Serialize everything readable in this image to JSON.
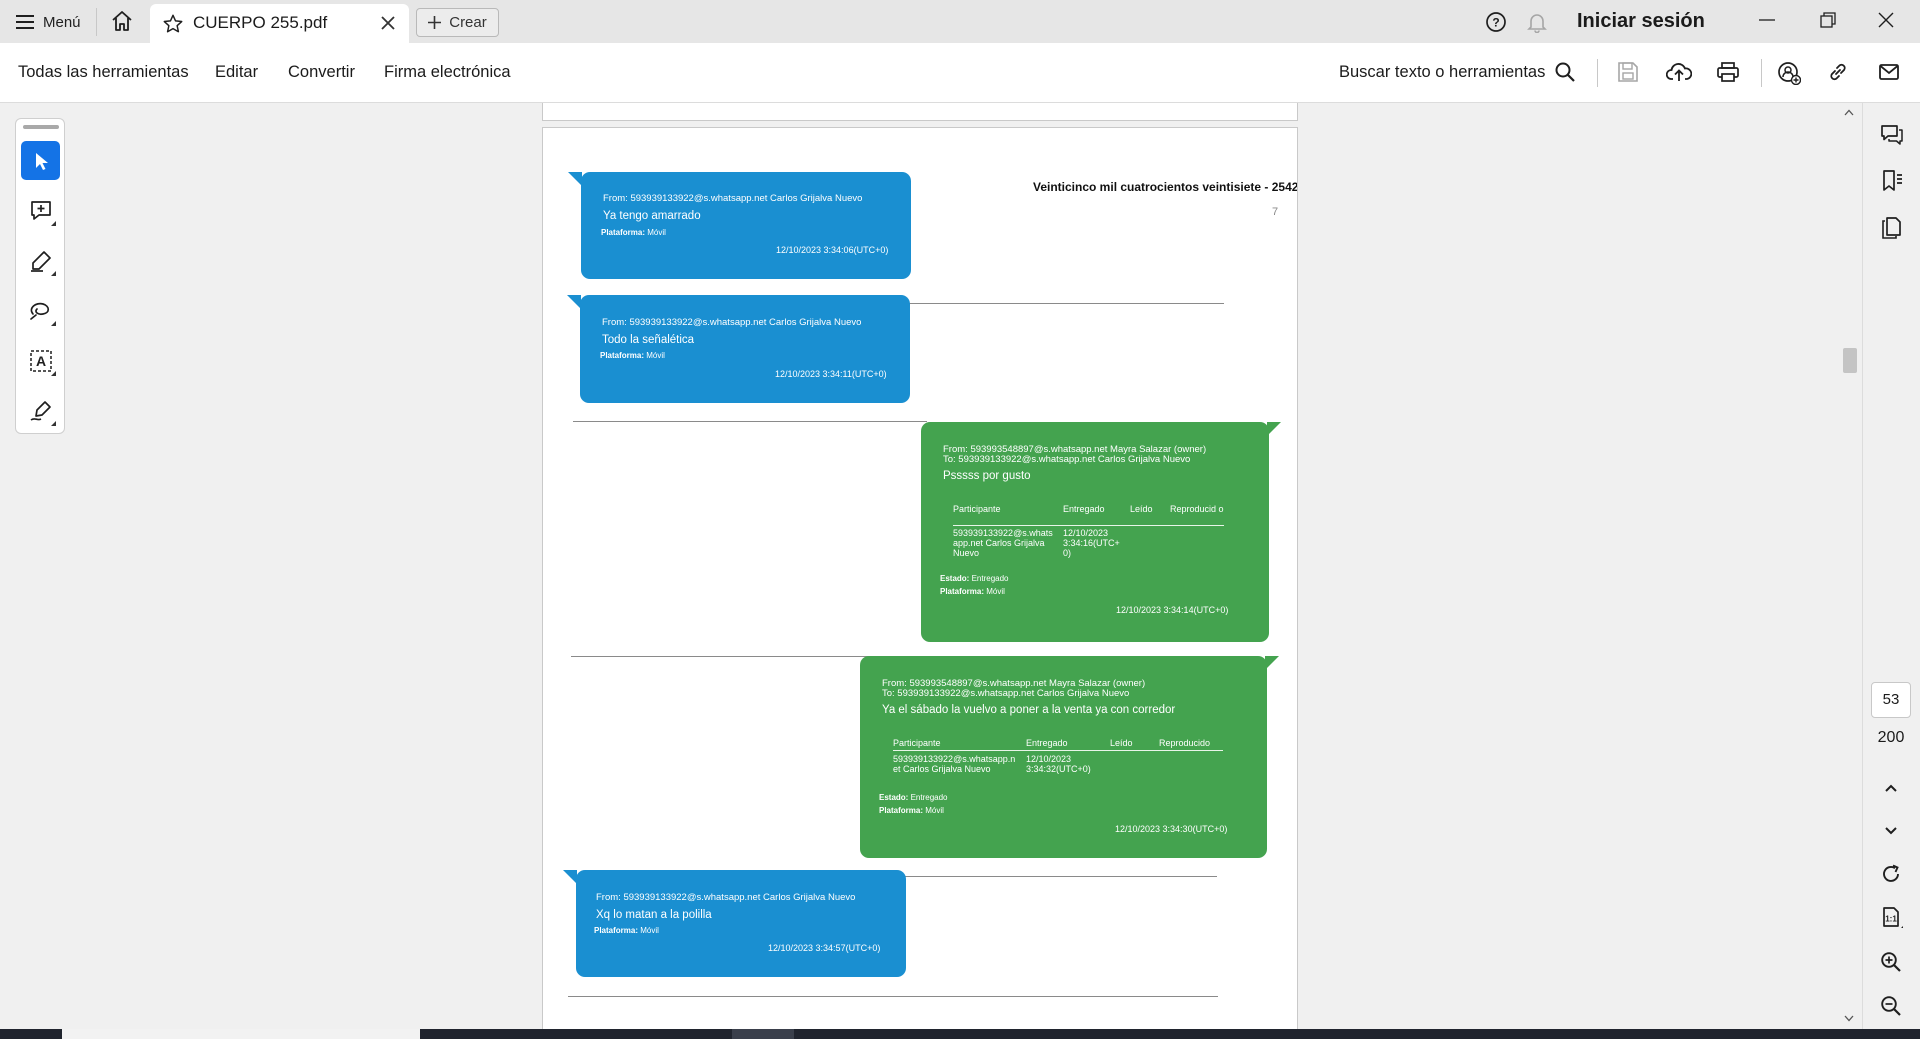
{
  "titlebar": {
    "menu_label": "Menú",
    "tab_title": "CUERPO 255.pdf",
    "create_label": "Crear",
    "signin_label": "Iniciar sesión"
  },
  "toolbar": {
    "items": [
      "Todas las herramientas",
      "Editar",
      "Convertir",
      "Firma electrónica"
    ],
    "search_label": "Buscar texto o herramientas"
  },
  "tools": [
    "select-tool",
    "add-comment-tool",
    "highlight-tool",
    "draw-tool",
    "text-select-tool",
    "sign-tool"
  ],
  "page": {
    "header": "Veinticinco mil cuatrocientos veintisiete - 2542",
    "corner_mark": "7"
  },
  "messages": [
    {
      "color": "#1a8fd1",
      "from": "From: 593939133922@s.whatsapp.net Carlos Grijalva Nuevo",
      "text": "Ya tengo amarrado",
      "platform_label": "Plataforma:",
      "platform": "Móvil",
      "timestamp": "12/10/2023 3:34:06(UTC+0)"
    },
    {
      "color": "#1a8fd1",
      "from": "From: 593939133922@s.whatsapp.net Carlos Grijalva Nuevo",
      "text": "Todo la señalética",
      "platform_label": "Plataforma:",
      "platform": "Móvil",
      "timestamp": "12/10/2023 3:34:11(UTC+0)"
    },
    {
      "color": "#44a34f",
      "from": "From: 593993548897@s.whatsapp.net Mayra Salazar (owner)",
      "to": "To: 593939133922@s.whatsapp.net Carlos Grijalva Nuevo",
      "text": "Psssss por gusto",
      "table_headers": [
        "Participante",
        "Entregado",
        "Leído",
        "Reproducid o"
      ],
      "participant": "593939133922@s.whats app.net Carlos Grijalva Nuevo",
      "delivered": "12/10/2023 3:34:16(UTC+ 0)",
      "estado_label": "Estado:",
      "estado": "Entregado",
      "platform_label": "Plataforma:",
      "platform": "Móvil",
      "timestamp": "12/10/2023 3:34:14(UTC+0)"
    },
    {
      "color": "#44a34f",
      "from": "From: 593993548897@s.whatsapp.net Mayra Salazar (owner)",
      "to": "To: 593939133922@s.whatsapp.net Carlos Grijalva Nuevo",
      "text": "Ya el sábado la vuelvo a poner a la venta ya con corredor",
      "table_headers": [
        "Participante",
        "Entregado",
        "Leído",
        "Reproducido"
      ],
      "participant": "593939133922@s.whatsapp.n et Carlos Grijalva Nuevo",
      "delivered": "12/10/2023 3:34:32(UTC+0)",
      "estado_label": "Estado:",
      "estado": "Entregado",
      "platform_label": "Plataforma:",
      "platform": "Móvil",
      "timestamp": "12/10/2023 3:34:30(UTC+0)"
    },
    {
      "color": "#1a8fd1",
      "from": "From: 593939133922@s.whatsapp.net Carlos Grijalva Nuevo",
      "text": "Xq lo matan a la polilla",
      "platform_label": "Plataforma:",
      "platform": "Móvil",
      "timestamp": "12/10/2023 3:34:57(UTC+0)"
    }
  ],
  "pagination": {
    "current_page": "53",
    "total_pages": "200"
  }
}
